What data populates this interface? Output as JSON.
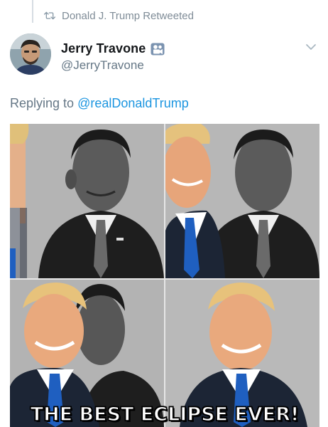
{
  "retweet": {
    "icon": "retweet-icon",
    "text": "Donald J. Trump Retweeted"
  },
  "author": {
    "display_name": "Jerry Travone",
    "handle": "@JerryTravone",
    "badge_icon": "camera-badge-icon",
    "avatar_icon": "profile-avatar"
  },
  "menu": {
    "icon": "chevron-down-icon"
  },
  "reply": {
    "prefix": "Replying to",
    "mention": "@realDonaldTrump"
  },
  "media": {
    "caption": "THE BEST ECLIPSE EVER!",
    "tiles": [
      "photo-1",
      "photo-2",
      "photo-3",
      "photo-4"
    ]
  },
  "colors": {
    "link": "#1b95e0",
    "secondary_text": "#657786",
    "name_text": "#14171a",
    "thread_line": "#d6dde3"
  }
}
